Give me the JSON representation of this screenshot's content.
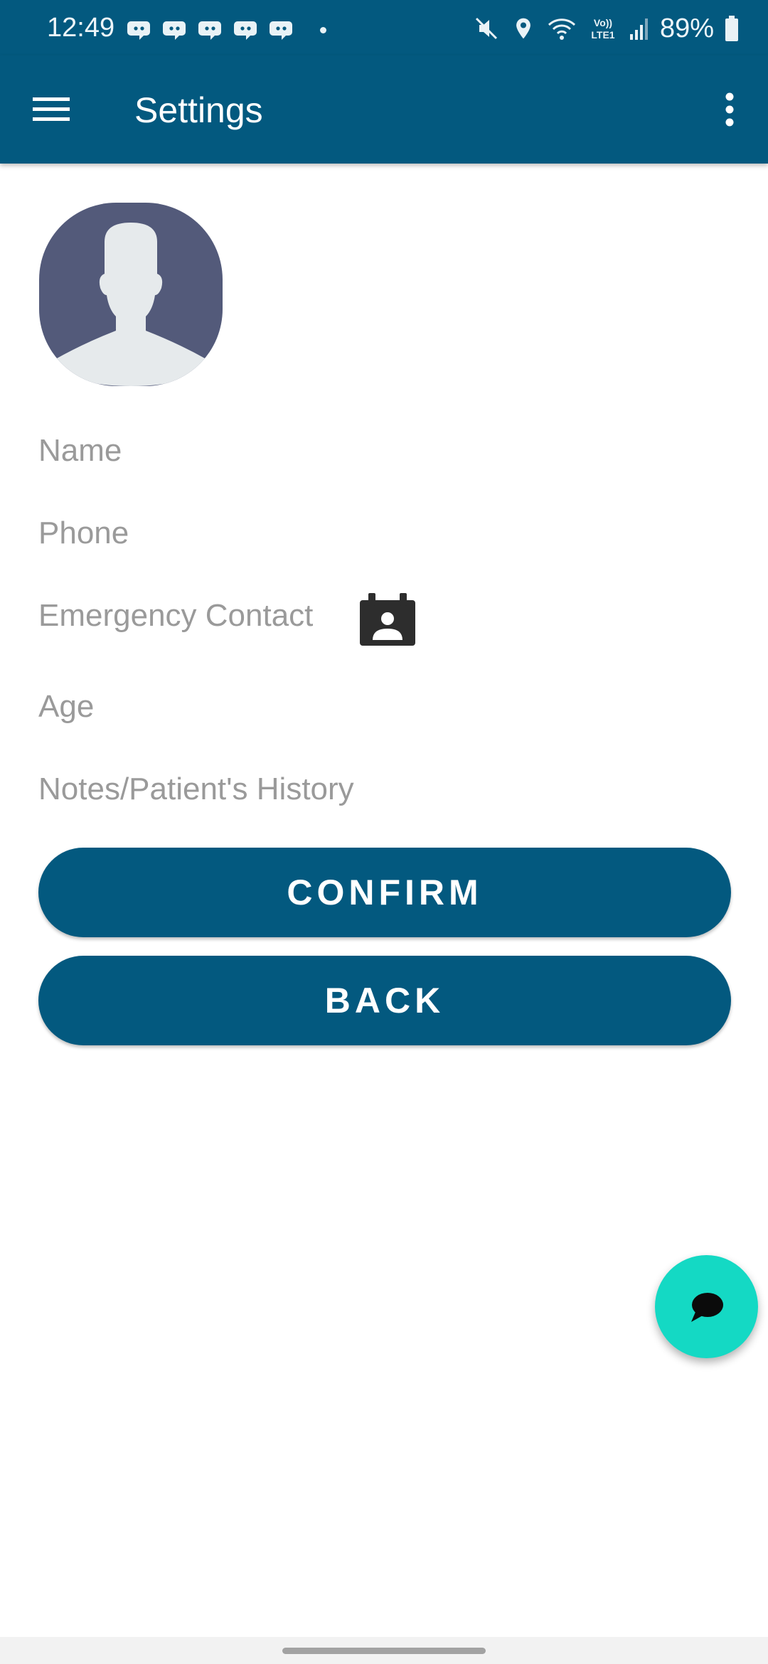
{
  "status_bar": {
    "time": "12:49",
    "notification_icons": [
      "discord-icon",
      "discord-icon",
      "discord-icon",
      "discord-icon",
      "discord-icon"
    ],
    "status_icons": [
      "mute-icon",
      "location-icon",
      "wifi-icon",
      "volte-icon",
      "signal-icon"
    ],
    "volte_top": "Vo))",
    "volte_bottom": "LTE1",
    "battery_percent": "89%"
  },
  "app_bar": {
    "title": "Settings",
    "background_color": "#03597f"
  },
  "form": {
    "name_label": "Name",
    "phone_label": "Phone",
    "emergency_contact_label": "Emergency Contact",
    "age_label": "Age",
    "notes_label": "Notes/Patient's History"
  },
  "buttons": {
    "confirm_label": "CONFIRM",
    "back_label": "BACK",
    "button_color": "#03597f"
  },
  "fab": {
    "icon": "chat-bubble-icon",
    "color": "#14d9c4"
  }
}
